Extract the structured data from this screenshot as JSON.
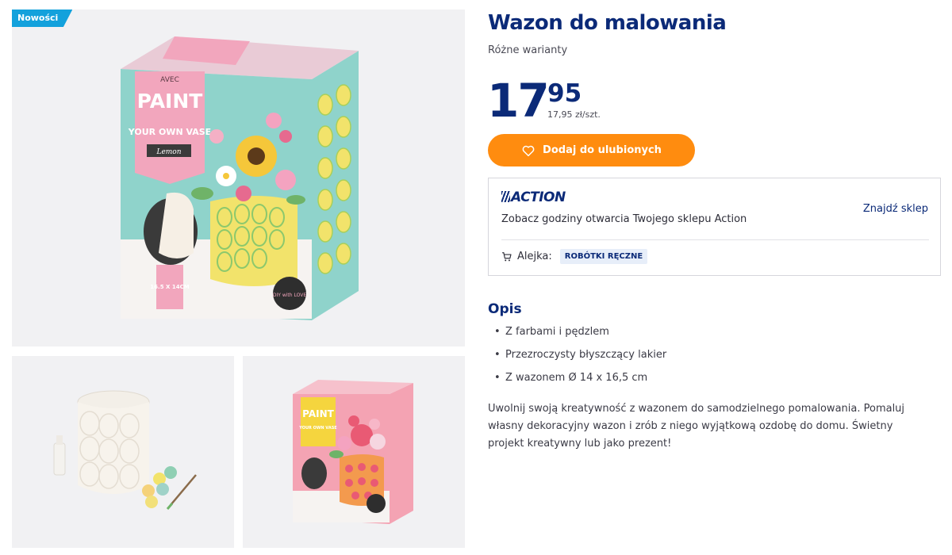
{
  "badge": {
    "label": "Nowości"
  },
  "gallery": {
    "main_box": {
      "brand": "AVEC",
      "headline": "PAINT",
      "subline": "YOUR OWN VASE",
      "variant": "Lemon",
      "size": "16.5 X 14CM",
      "sticker": "DIY with LOVE"
    },
    "thumb2_box": {
      "headline": "PAINT",
      "subline": "YOUR OWN VASE"
    }
  },
  "product": {
    "title": "Wazon do malowania",
    "subtitle": "Różne warianty",
    "price_int": "17",
    "price_dec": "95",
    "unit_price": "17,95 zł/szt.",
    "favorite_label": "Dodaj do ulubionych"
  },
  "store": {
    "logo": "ACTION",
    "hours_text": "Zobacz godziny otwarcia Twojego sklepu Action",
    "find_label": "Znajdź sklep",
    "aisle_label": "Alejka:",
    "aisle_value": "ROBÓTKI RĘCZNE"
  },
  "description": {
    "heading": "Opis",
    "features": [
      "Z farbami i pędzlem",
      "Przezroczysty błyszczący lakier",
      "Z wazonem Ø 14 x 16,5 cm"
    ],
    "text": "Uwolnij swoją kreatywność z wazonem do samodzielnego pomalowania. Pomaluj własny dekoracyjny wazon i zrób z niego wyjątkową ozdobę do domu. Świetny projekt kreatywny lub jako prezent!"
  },
  "colors": {
    "brand_blue": "#0b2a78",
    "badge_blue": "#13a1dc",
    "orange": "#ff8c0f",
    "box_pink": "#f2a6bd",
    "box_teal": "#8fd3cb",
    "vase_yellow": "#f2e36b"
  },
  "icons": {
    "favorite": "heart-outline-icon",
    "aisle": "shopping-cart-icon"
  }
}
